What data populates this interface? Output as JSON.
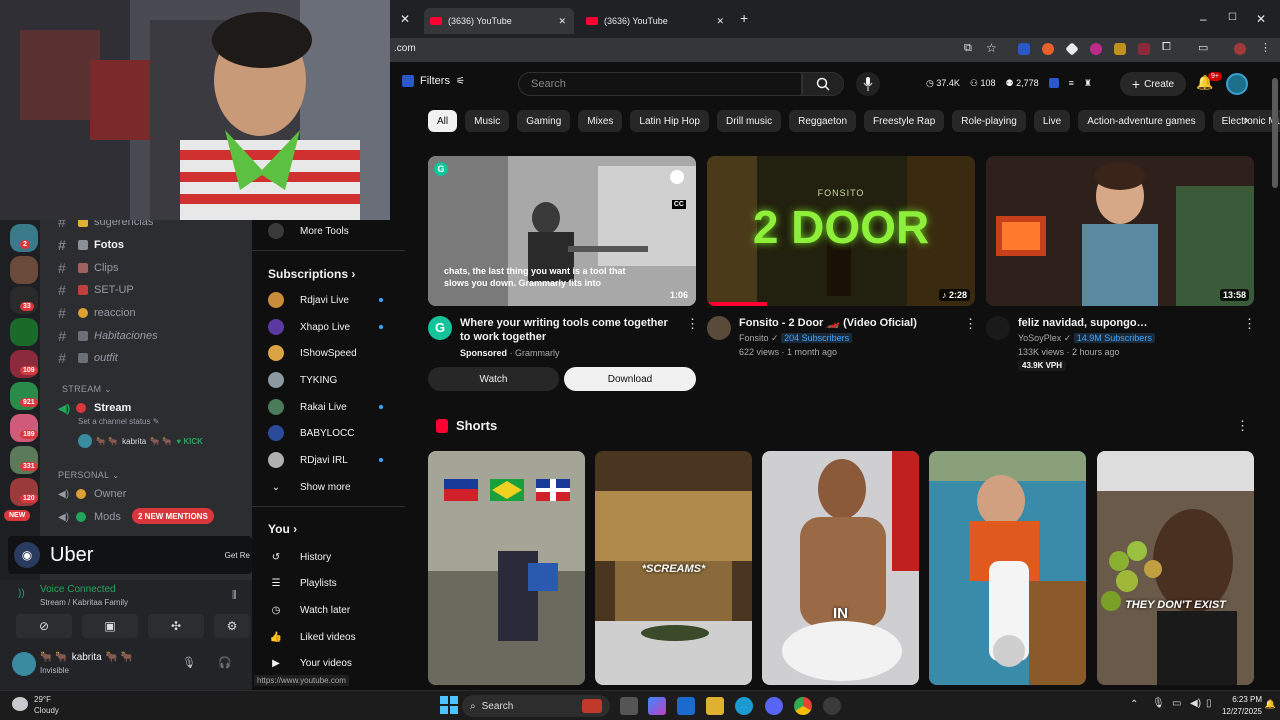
{
  "browser": {
    "tabs": [
      {
        "label": "(3636) YouTube",
        "icon": "youtube-icon"
      },
      {
        "label": "(3636) YouTube",
        "icon": "youtube-icon"
      }
    ],
    "new_tab": "+",
    "url": ".com",
    "window_controls": {
      "minimize": "–",
      "maximize": "☐",
      "close": "✕"
    }
  },
  "youtube": {
    "filters_label": "Filters",
    "search_placeholder": "Search",
    "stats": {
      "views": "37.4K",
      "likes": "108",
      "subs": "2,778"
    },
    "create_label": "Create",
    "notifications": "9+",
    "chips": [
      "All",
      "Music",
      "Gaming",
      "Mixes",
      "Latin Hip Hop",
      "Drill music",
      "Reggaeton",
      "Freestyle Rap",
      "Role-playing",
      "Live",
      "Action-adventure games",
      "Electronic Music"
    ],
    "videos": [
      {
        "title": "Where your writing tools come together to work together",
        "sponsored": "Sponsored",
        "channel": "Grammarly",
        "duration": "1:06",
        "overlay_text": "chats, the last thing you want is a tool that slows you down. Grammarly fits into",
        "cc": "CC",
        "watch_label": "Watch",
        "download_label": "Download"
      },
      {
        "title": "Fonsito - 2 Door 🏎️ (Video Oficial)",
        "channel": "Fonsito",
        "subscribers": "204 Subscribers",
        "views": "622 views",
        "age": "1 month ago",
        "duration": "2:28",
        "thumb_text": "2 DOOR",
        "thumb_small": "FONSITO"
      },
      {
        "title": "feliz navidad, supongo…",
        "channel": "YoSoyPlex",
        "subscribers": "14.9M Subscribers",
        "views": "133K views",
        "age": "2 hours ago",
        "vph": "43.9K VPH",
        "duration": "13:58"
      }
    ],
    "shorts_title": "Shorts",
    "shorts": [
      {
        "caption": ""
      },
      {
        "caption": "*SCREAMS*"
      },
      {
        "caption": "IN"
      },
      {
        "caption": ""
      },
      {
        "caption": "THEY DON'T EXIST"
      }
    ],
    "sidebar": {
      "more_tools": "More Tools",
      "subscriptions_title": "Subscriptions",
      "subscriptions": [
        {
          "name": "Rdjavi Live",
          "live": true,
          "color": "#c98c3a"
        },
        {
          "name": "Xhapo Live",
          "live": true,
          "color": "#5a3aa0"
        },
        {
          "name": "IShowSpeed",
          "live": false,
          "color": "#d9a441"
        },
        {
          "name": "TYKING",
          "live": false,
          "color": "#8a9aa0"
        },
        {
          "name": "Rakai Live",
          "live": true,
          "color": "#4a7a5a"
        },
        {
          "name": "BABYLOCC",
          "live": false,
          "color": "#2a4a9a"
        },
        {
          "name": "RDjavi IRL",
          "live": true,
          "color": "#b0b0b0"
        }
      ],
      "show_more": "Show more",
      "you_title": "You",
      "you_items": [
        "History",
        "Playlists",
        "Watch later",
        "Liked videos",
        "Your videos"
      ]
    },
    "status_url": "https://www.youtube.com"
  },
  "discord": {
    "channels": [
      {
        "name": "sugerencias",
        "active": false
      },
      {
        "name": "Fotos",
        "active": true
      },
      {
        "name": "Clips",
        "active": false
      },
      {
        "name": "SET-UP",
        "active": false
      },
      {
        "name": "reaccion",
        "active": false
      },
      {
        "name": "Habitaciones",
        "active": false
      },
      {
        "name": "outfit",
        "active": false
      }
    ],
    "stream_category": "STREAM",
    "stream_channel": "Stream",
    "stream_status": "Set a channel status",
    "stream_user": "kabrita",
    "kick_label": "KICK",
    "personal_category": "PERSONAL",
    "owner_channel": "Owner",
    "mods_channel": "Mods",
    "new_mentions": "2 NEW MENTIONS",
    "new_badge": "NEW",
    "server_badges": [
      "2",
      "33",
      "109",
      "921",
      "189",
      "331",
      "120"
    ],
    "uber_label": "Uber",
    "uber_action": "Get Re",
    "voice_connected": "Voice Connected",
    "voice_channel": "Stream / Kabritaa Family",
    "user_name": "kabrita",
    "user_status": "Invisible"
  },
  "taskbar": {
    "weather_temp": "29°F",
    "weather_desc": "Cloudy",
    "search_label": "Search",
    "time": "6:23 PM",
    "date": "12/27/2025"
  }
}
